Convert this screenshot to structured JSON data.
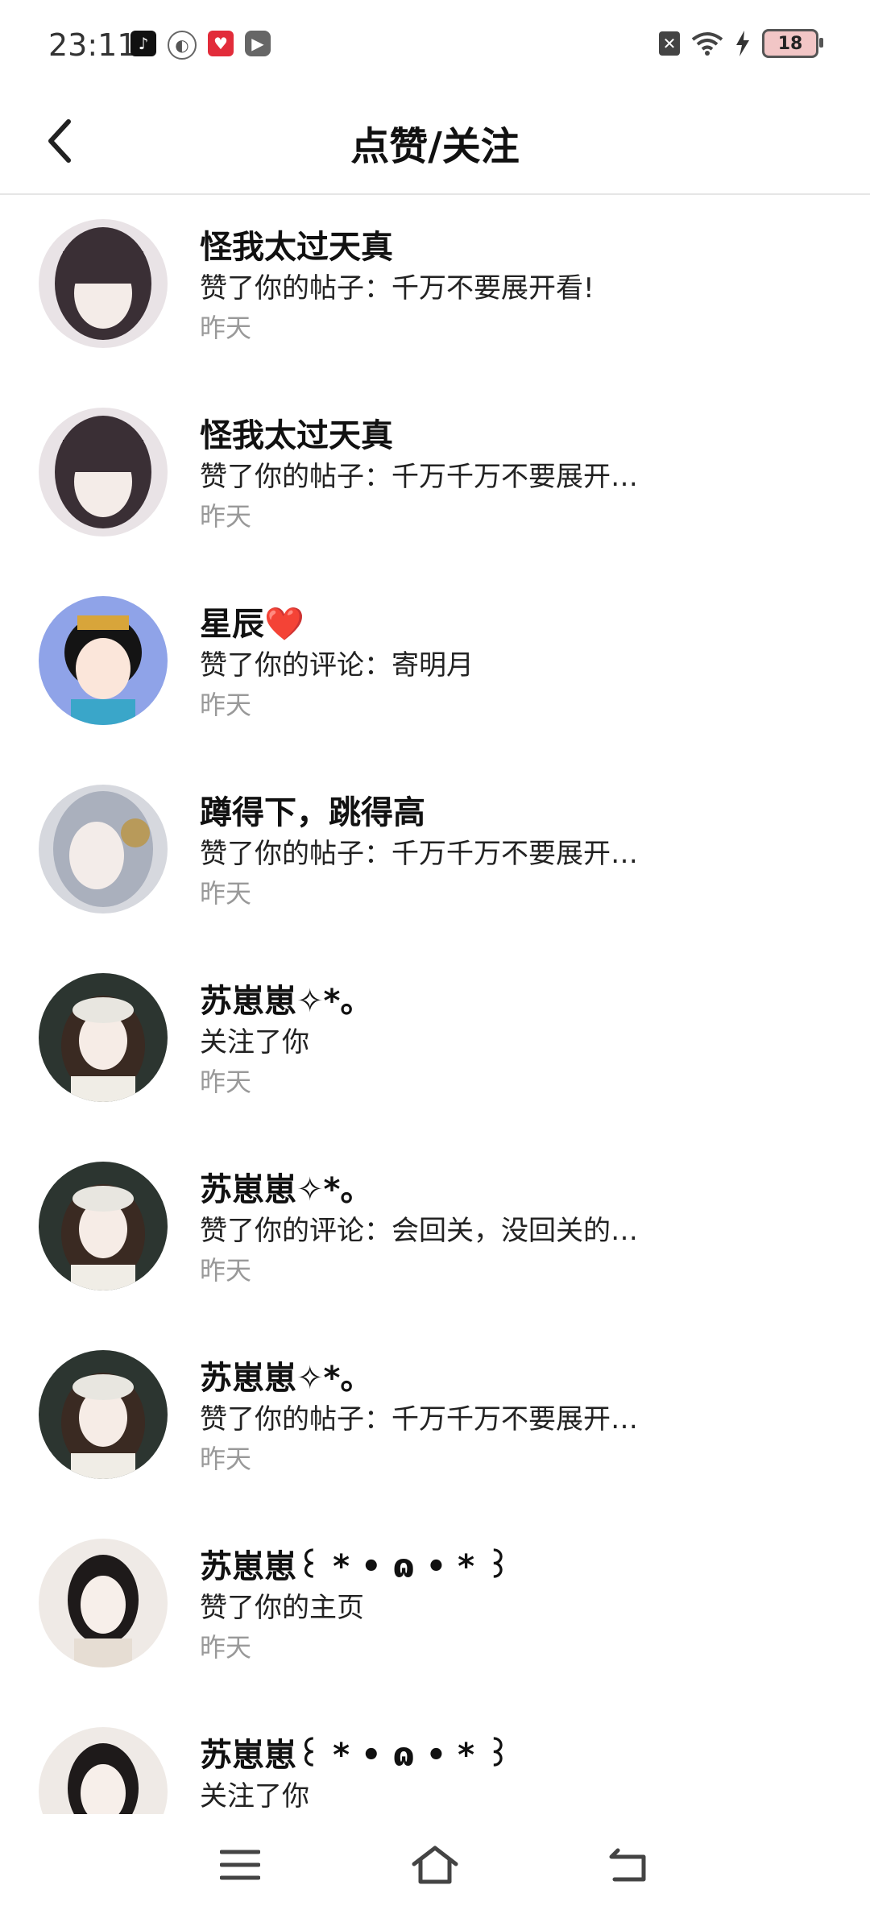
{
  "status_bar": {
    "time": "23:11",
    "left_icons": [
      "tiktok-icon",
      "swirl-app-icon",
      "heart-app-icon",
      "play-app-icon"
    ],
    "right_icons": [
      "sim-off-icon",
      "wifi-icon",
      "charging-icon"
    ],
    "battery": "18"
  },
  "header": {
    "back_icon": "chevron-left-icon",
    "title": "点赞/关注"
  },
  "notifications": [
    {
      "name": "怪我太过天真",
      "action": "赞了你的帖子：千万不要展开看!",
      "time": "昨天",
      "avatar_bg": "#c9b6c2"
    },
    {
      "name": "怪我太过天真",
      "action": "赞了你的帖子：千万千万不要展开…",
      "time": "昨天",
      "avatar_bg": "#c9b6c2"
    },
    {
      "name": "星辰❤️",
      "action": "赞了你的评论：寄明月",
      "time": "昨天",
      "avatar_bg": "#8fa3e8"
    },
    {
      "name": "蹲得下，跳得高",
      "action": "赞了你的帖子：千万千万不要展开…",
      "time": "昨天",
      "avatar_bg": "#c9ccd6"
    },
    {
      "name": "苏崽崽✧*。",
      "action": "关注了你",
      "time": "昨天",
      "avatar_bg": "#2c3530"
    },
    {
      "name": "苏崽崽✧*。",
      "action": "赞了你的评论：会回关，没回关的…",
      "time": "昨天",
      "avatar_bg": "#2c3530"
    },
    {
      "name": "苏崽崽✧*。",
      "action": "赞了你的帖子：千万千万不要展开…",
      "time": "昨天",
      "avatar_bg": "#2c3530"
    },
    {
      "name": "苏崽崽꒰ * • ɷ • * ꒱",
      "action": "赞了你的主页",
      "time": "昨天",
      "avatar_bg": "#efeae6"
    },
    {
      "name": "苏崽崽꒰ * • ɷ • * ꒱",
      "action": "关注了你",
      "time": "",
      "avatar_bg": "#efeae6"
    }
  ],
  "nav_bar": {
    "buttons": [
      "menu-icon",
      "home-icon",
      "back-nav-icon"
    ]
  }
}
